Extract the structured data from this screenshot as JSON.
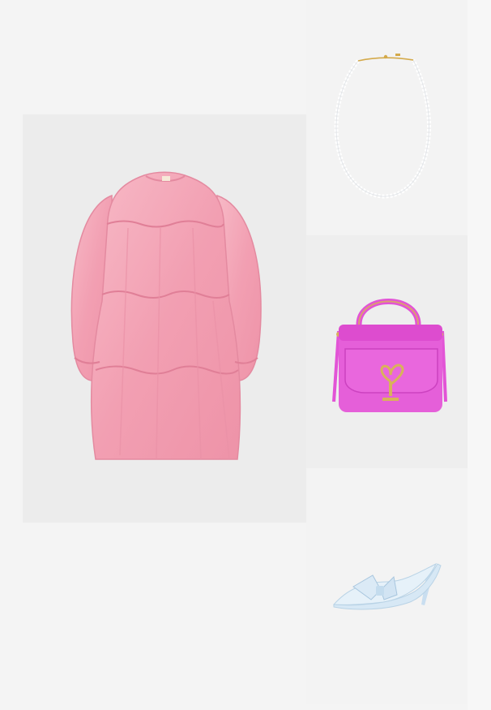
{
  "board": {
    "items": [
      {
        "id": "dress",
        "icon": "pink-tiered-dress-image"
      },
      {
        "id": "necklace",
        "icon": "pearl-necklace-image"
      },
      {
        "id": "bag",
        "icon": "pink-handbag-image"
      },
      {
        "id": "shoe",
        "icon": "blue-bow-mule-image"
      }
    ]
  },
  "colors": {
    "page_background": "#f4f4f4",
    "dress_pink": "#f4a6b6",
    "bag_magenta": "#e254d6",
    "hardware_gold": "#d9b25a",
    "shoe_blue": "#cfe4f2"
  }
}
